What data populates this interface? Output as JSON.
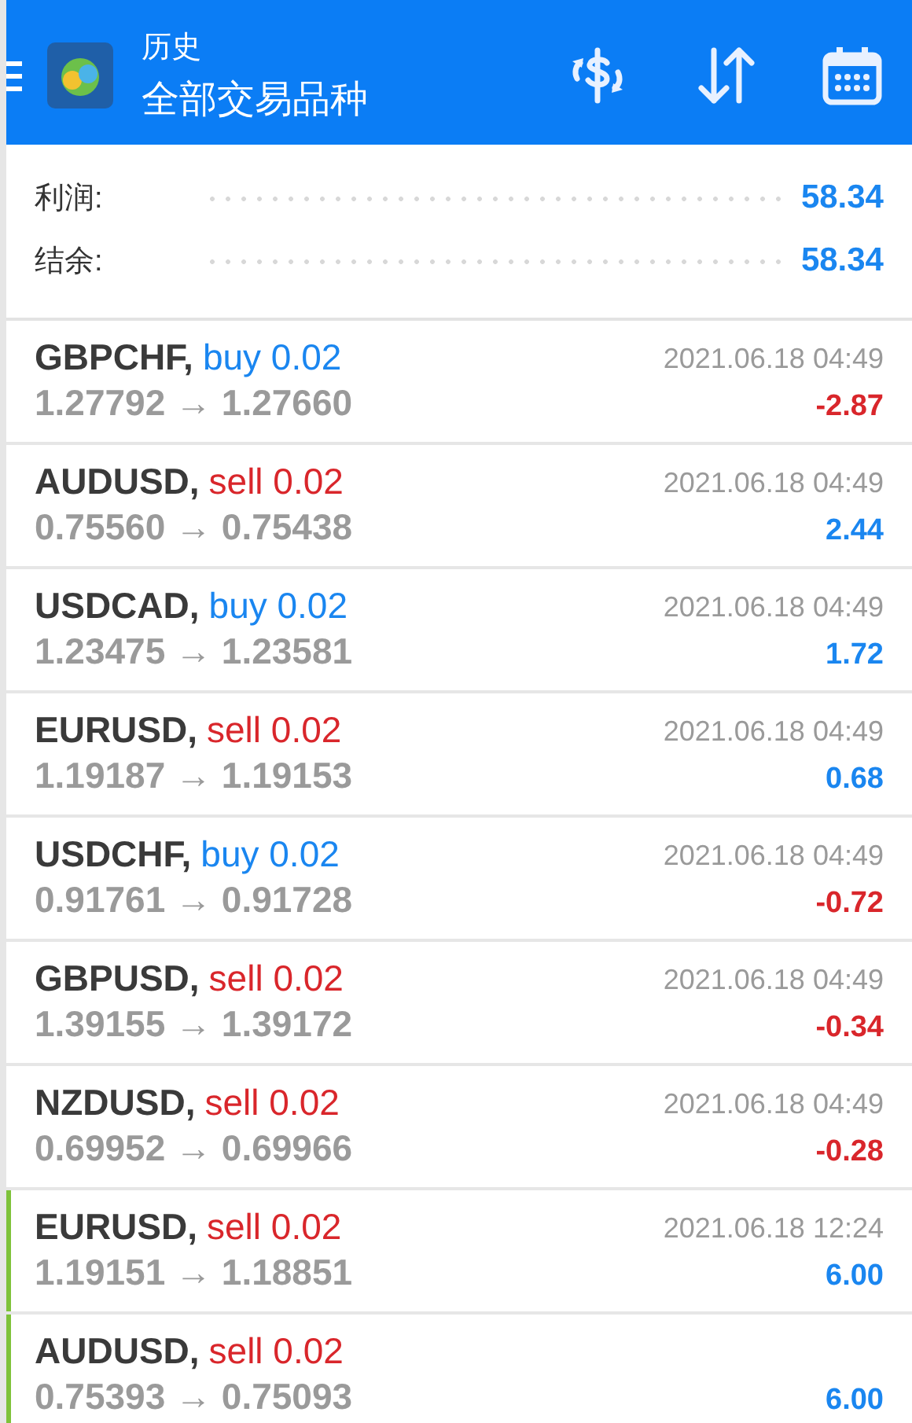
{
  "header": {
    "title": "历史",
    "subtitle": "全部交易品种"
  },
  "summary": [
    {
      "label": "利润:",
      "value": "58.34"
    },
    {
      "label": "结余:",
      "value": "58.34"
    }
  ],
  "trades": [
    {
      "symbol": "GBPCHF,",
      "kind": "buy",
      "order": "buy 0.02",
      "prices": "1.27792 → 1.27660",
      "time": "2021.06.18 04:49",
      "profit": "-2.87",
      "loss": true,
      "marked": false
    },
    {
      "symbol": "AUDUSD,",
      "kind": "sell",
      "order": "sell 0.02",
      "prices": "0.75560 → 0.75438",
      "time": "2021.06.18 04:49",
      "profit": "2.44",
      "loss": false,
      "marked": false
    },
    {
      "symbol": "USDCAD,",
      "kind": "buy",
      "order": "buy 0.02",
      "prices": "1.23475 → 1.23581",
      "time": "2021.06.18 04:49",
      "profit": "1.72",
      "loss": false,
      "marked": false
    },
    {
      "symbol": "EURUSD,",
      "kind": "sell",
      "order": "sell 0.02",
      "prices": "1.19187 → 1.19153",
      "time": "2021.06.18 04:49",
      "profit": "0.68",
      "loss": false,
      "marked": false
    },
    {
      "symbol": "USDCHF,",
      "kind": "buy",
      "order": "buy 0.02",
      "prices": "0.91761 → 0.91728",
      "time": "2021.06.18 04:49",
      "profit": "-0.72",
      "loss": true,
      "marked": false
    },
    {
      "symbol": "GBPUSD,",
      "kind": "sell",
      "order": "sell 0.02",
      "prices": "1.39155 → 1.39172",
      "time": "2021.06.18 04:49",
      "profit": "-0.34",
      "loss": true,
      "marked": false
    },
    {
      "symbol": "NZDUSD,",
      "kind": "sell",
      "order": "sell 0.02",
      "prices": "0.69952 → 0.69966",
      "time": "2021.06.18 04:49",
      "profit": "-0.28",
      "loss": true,
      "marked": false
    },
    {
      "symbol": "EURUSD,",
      "kind": "sell",
      "order": "sell 0.02",
      "prices": "1.19151 → 1.18851",
      "time": "2021.06.18 12:24",
      "profit": "6.00",
      "loss": false,
      "marked": true
    },
    {
      "symbol": "AUDUSD,",
      "kind": "sell",
      "order": "sell 0.02",
      "prices": "0.75393 → 0.75093",
      "profit": "6.00",
      "loss": false,
      "marked": true
    }
  ]
}
